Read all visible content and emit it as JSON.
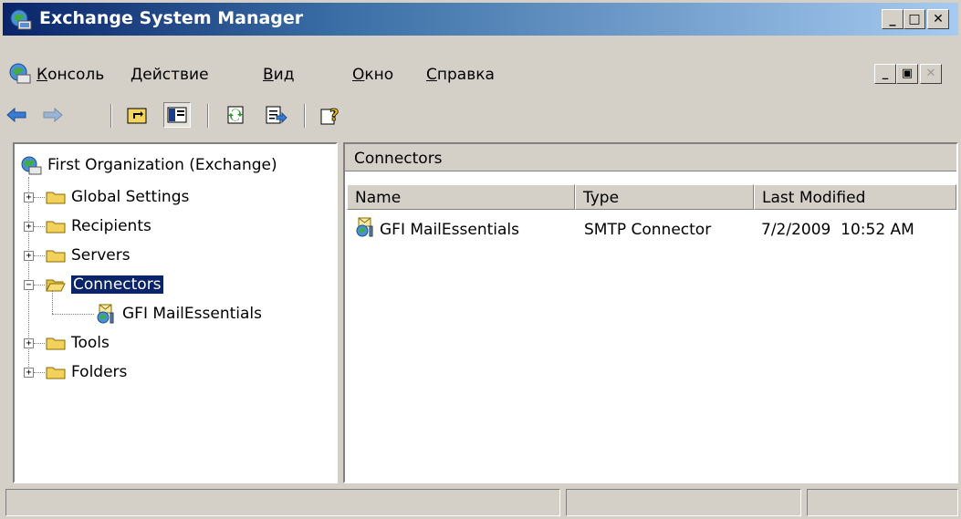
{
  "window": {
    "title": "Exchange System Manager"
  },
  "menu": {
    "items": [
      "Консоль",
      "Действие",
      "Вид",
      "Окно",
      "Справка"
    ],
    "accelerators": [
      "К",
      "Д",
      "В",
      "О",
      "С"
    ]
  },
  "toolbar": {
    "icons": [
      "back-arrow-icon",
      "forward-arrow-icon",
      "up-folder-icon",
      "show-tree-icon",
      "refresh-icon",
      "export-list-icon",
      "help-icon"
    ]
  },
  "tree": {
    "root": "First Organization (Exchange)",
    "items": [
      {
        "label": "Global Settings",
        "expander": "+"
      },
      {
        "label": "Recipients",
        "expander": "+"
      },
      {
        "label": "Servers",
        "expander": "+"
      },
      {
        "label": "Connectors",
        "expander": "−",
        "selected": true
      },
      {
        "label": "GFI MailEssentials",
        "child": true
      },
      {
        "label": "Tools",
        "expander": "+"
      },
      {
        "label": "Folders",
        "expander": "+"
      }
    ]
  },
  "details": {
    "header": "Connectors",
    "columns": [
      "Name",
      "Type",
      "Last Modified"
    ],
    "rows": [
      {
        "name": "GFI MailEssentials",
        "type": "SMTP Connector",
        "modified": "7/2/2009  10:52 AM"
      }
    ]
  },
  "colors": {
    "title_start": "#0a246a",
    "title_end": "#a6caf0",
    "face": "#d4d0c8",
    "selection": "#0a246a"
  }
}
